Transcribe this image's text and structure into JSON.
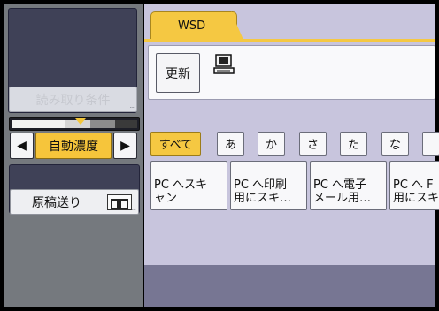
{
  "left_panel": {
    "scan_settings_label": "読み取り条件",
    "density_label": "自動濃度",
    "density_left_arrow": "◀",
    "density_right_arrow": "▶",
    "original_feed_label": "原稿送り",
    "original_feed_icon": "original-feed-icon"
  },
  "tab": {
    "label": "WSD"
  },
  "destination_panel": {
    "refresh_label": "更新",
    "computer_icon": "computer-icon"
  },
  "kana_filters": [
    {
      "label": "すべて",
      "selected": true
    },
    {
      "label": "あ"
    },
    {
      "label": "か"
    },
    {
      "label": "さ"
    },
    {
      "label": "た"
    },
    {
      "label": "な"
    }
  ],
  "destinations": [
    {
      "label": "PC へスキ\nャン"
    },
    {
      "label": "PC へ印刷\n用にスキ…"
    },
    {
      "label": "PC へ電子\nメール用…"
    },
    {
      "label": "PC へ F\n用にスキ"
    }
  ],
  "colors": {
    "accent": "#f5c842",
    "panel_bg": "#c8c5dd",
    "left_bg": "#75797e",
    "dark_panel": "#3f4157"
  }
}
